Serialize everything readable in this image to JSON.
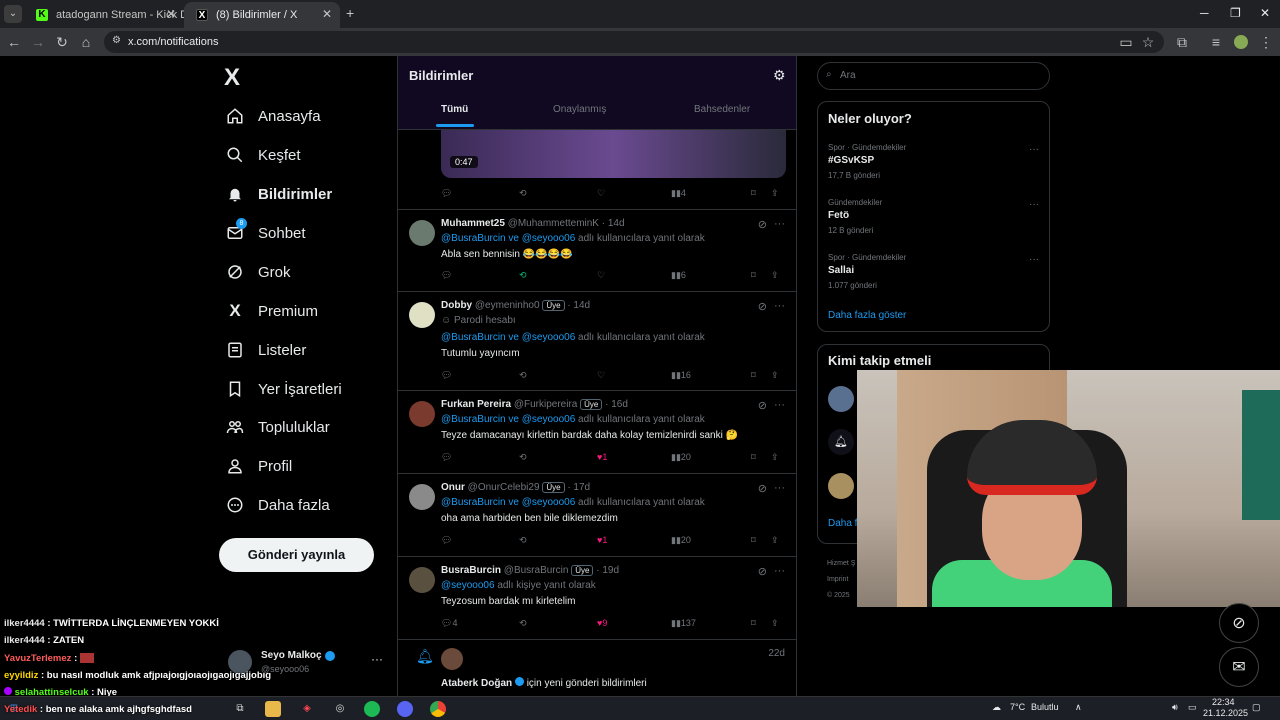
{
  "browser": {
    "tabs": [
      {
        "label": "atadogann Stream - Kick Dashb..."
      },
      {
        "label": "(8) Bildirimler / X"
      }
    ],
    "url": "x.com/notifications"
  },
  "x_logo": "X",
  "nav": {
    "items": [
      {
        "label": "Anasayfa",
        "icon": "home-icon"
      },
      {
        "label": "Keşfet",
        "icon": "search-icon"
      },
      {
        "label": "Bildirimler",
        "icon": "bell-icon"
      },
      {
        "label": "Sohbet",
        "icon": "mail-icon",
        "badge": "8"
      },
      {
        "label": "Grok",
        "icon": "grok-icon"
      },
      {
        "label": "Premium",
        "icon": "x-icon"
      },
      {
        "label": "Listeler",
        "icon": "list-icon"
      },
      {
        "label": "Yer İşaretleri",
        "icon": "bookmark-icon"
      },
      {
        "label": "Topluluklar",
        "icon": "community-icon"
      },
      {
        "label": "Profil",
        "icon": "profile-icon"
      },
      {
        "label": "Daha fazla",
        "icon": "more-icon"
      }
    ],
    "post_button": "Gönderi yayınla",
    "account": {
      "name": "Seyo Malkoç",
      "handle": "@seyooo06"
    }
  },
  "main": {
    "title": "Bildirimler",
    "tabs": [
      "Tümü",
      "Onaylanmış",
      "Bahsedenler"
    ],
    "video_duration": "0:47",
    "first_row_views": "4",
    "posts": [
      {
        "name": "Muhammet25",
        "handle": "@MuhammetteminK",
        "time": "· 14d",
        "badge": "",
        "parody": "",
        "reply_to": "@BusraBurcin ve @seyooo06",
        "reply_suffix": "adlı kullanıcılara yanıt olarak",
        "text": "Abla sen bennisin 😂😂😂😂",
        "replies": "",
        "likes": "",
        "views": "6",
        "liked": false
      },
      {
        "name": "Dobby",
        "handle": "@eymeninho0",
        "time": "· 14d",
        "badge": "Üye",
        "parody": "Parodi hesabı",
        "reply_to": "@BusraBurcin ve @seyooo06",
        "reply_suffix": "adlı kullanıcılara yanıt olarak",
        "text": "Tutumlu yayıncım",
        "replies": "",
        "likes": "",
        "views": "16",
        "liked": false
      },
      {
        "name": "Furkan Pereira",
        "handle": "@Furkipereira",
        "time": "· 16d",
        "badge": "Üye",
        "parody": "",
        "reply_to": "@BusraBurcin ve @seyooo06",
        "reply_suffix": "adlı kullanıcılara yanıt olarak",
        "text": "Teyze damacanayı kirlettin bardak daha kolay temizlenirdi sanki 🤔",
        "replies": "",
        "likes": "1",
        "views": "20",
        "liked": true
      },
      {
        "name": "Onur",
        "handle": "@OnurCelebi29",
        "time": "· 17d",
        "badge": "Üye",
        "parody": "",
        "reply_to": "@BusraBurcin ve @seyooo06",
        "reply_suffix": "adlı kullanıcılara yanıt olarak",
        "text": "oha ama harbiden ben bile diklemezdim",
        "replies": "",
        "likes": "1",
        "views": "20",
        "liked": true
      },
      {
        "name": "BusraBurcin",
        "handle": "@BusraBurcin",
        "time": "· 19d",
        "badge": "Üye",
        "parody": "",
        "reply_to": "@seyooo06",
        "reply_suffix": "adlı kişiye yanıt olarak",
        "text": "Teyzosum bardak mı kirletelim",
        "replies": "4",
        "likes": "9",
        "views": "137",
        "liked": true
      }
    ],
    "last_notification": {
      "name": "Ataberk Doğan",
      "text": "için yeni gönderi bildirimleri",
      "time": "22d"
    }
  },
  "sidebar_right": {
    "search_placeholder": "Ara",
    "trends_title": "Neler oluyor?",
    "trends": [
      {
        "category": "Spor · Gündemdekiler",
        "name": "#GSvKSP",
        "count": "17,7 B gönderi"
      },
      {
        "category": "Gündemdekiler",
        "name": "Fetö",
        "count": "12 B gönderi"
      },
      {
        "category": "Spor · Gündemdekiler",
        "name": "Sallai",
        "count": "1.077 gönderi"
      }
    ],
    "show_more": "Daha fazla göster",
    "follow_title": "Kimi takip etmeli",
    "follow_show_more": "Daha f",
    "footer": [
      "Hizmet Ş",
      "Imprint",
      "© 2025"
    ]
  },
  "chat": [
    {
      "user": "ilker4444",
      "msg": ": TWİTTERDA LİNÇLENMEYEN YOKKİ"
    },
    {
      "user": "ilker4444",
      "msg": ": ZATEN"
    },
    {
      "user": "YavuzTerlemez",
      "msg": ":"
    },
    {
      "user": "eyyildiz",
      "msg": ": bu nasıl modluk amk afjpıajoıgjoıaojıgaojıgajjobıg"
    },
    {
      "user": "selahattinselcuk",
      "msg": ": Niye"
    },
    {
      "user": "Yetedik",
      "msg": ": ben ne alaka amk ajhgfsghdfasd"
    }
  ],
  "taskbar": {
    "weather": "7°C",
    "weather_text": "Bulutlu",
    "time": "22:34",
    "date": "21.12.2025"
  }
}
